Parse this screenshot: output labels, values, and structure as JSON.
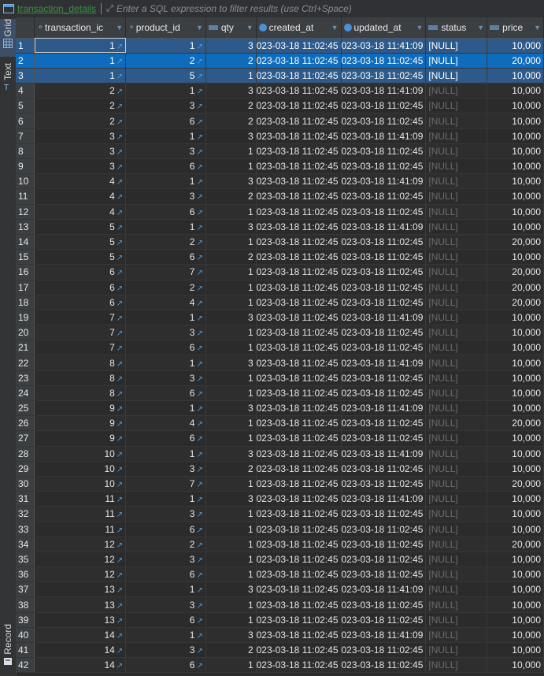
{
  "toolbar": {
    "table_name": "transaction_details",
    "filter_placeholder": "Enter a SQL expression to filter results (use Ctrl+Space)"
  },
  "side_tabs": [
    "Grid",
    "Text",
    "Record"
  ],
  "columns": [
    "transaction_ic",
    "product_id",
    "qty",
    "created_at",
    "updated_at",
    "status",
    "price"
  ],
  "rows": [
    {
      "n": "1",
      "t": "1",
      "p": "1",
      "q": "3",
      "c": "023-03-18 11:02:45",
      "u": "023-03-18 11:41:09",
      "s": "[NULL]",
      "pr": "10,000"
    },
    {
      "n": "2",
      "t": "1",
      "p": "2",
      "q": "2",
      "c": "023-03-18 11:02:45",
      "u": "023-03-18 11:02:45",
      "s": "[NULL]",
      "pr": "20,000"
    },
    {
      "n": "3",
      "t": "1",
      "p": "5",
      "q": "1",
      "c": "023-03-18 11:02:45",
      "u": "023-03-18 11:02:45",
      "s": "[NULL]",
      "pr": "10,000"
    },
    {
      "n": "4",
      "t": "2",
      "p": "1",
      "q": "3",
      "c": "023-03-18 11:02:45",
      "u": "023-03-18 11:41:09",
      "s": "[NULL]",
      "pr": "10,000"
    },
    {
      "n": "5",
      "t": "2",
      "p": "3",
      "q": "2",
      "c": "023-03-18 11:02:45",
      "u": "023-03-18 11:02:45",
      "s": "[NULL]",
      "pr": "10,000"
    },
    {
      "n": "6",
      "t": "2",
      "p": "6",
      "q": "2",
      "c": "023-03-18 11:02:45",
      "u": "023-03-18 11:02:45",
      "s": "[NULL]",
      "pr": "10,000"
    },
    {
      "n": "7",
      "t": "3",
      "p": "1",
      "q": "3",
      "c": "023-03-18 11:02:45",
      "u": "023-03-18 11:41:09",
      "s": "[NULL]",
      "pr": "10,000"
    },
    {
      "n": "8",
      "t": "3",
      "p": "3",
      "q": "1",
      "c": "023-03-18 11:02:45",
      "u": "023-03-18 11:02:45",
      "s": "[NULL]",
      "pr": "10,000"
    },
    {
      "n": "9",
      "t": "3",
      "p": "6",
      "q": "1",
      "c": "023-03-18 11:02:45",
      "u": "023-03-18 11:02:45",
      "s": "[NULL]",
      "pr": "10,000"
    },
    {
      "n": "10",
      "t": "4",
      "p": "1",
      "q": "3",
      "c": "023-03-18 11:02:45",
      "u": "023-03-18 11:41:09",
      "s": "[NULL]",
      "pr": "10,000"
    },
    {
      "n": "11",
      "t": "4",
      "p": "3",
      "q": "2",
      "c": "023-03-18 11:02:45",
      "u": "023-03-18 11:02:45",
      "s": "[NULL]",
      "pr": "10,000"
    },
    {
      "n": "12",
      "t": "4",
      "p": "6",
      "q": "1",
      "c": "023-03-18 11:02:45",
      "u": "023-03-18 11:02:45",
      "s": "[NULL]",
      "pr": "10,000"
    },
    {
      "n": "13",
      "t": "5",
      "p": "1",
      "q": "3",
      "c": "023-03-18 11:02:45",
      "u": "023-03-18 11:41:09",
      "s": "[NULL]",
      "pr": "10,000"
    },
    {
      "n": "14",
      "t": "5",
      "p": "2",
      "q": "1",
      "c": "023-03-18 11:02:45",
      "u": "023-03-18 11:02:45",
      "s": "[NULL]",
      "pr": "20,000"
    },
    {
      "n": "15",
      "t": "5",
      "p": "6",
      "q": "2",
      "c": "023-03-18 11:02:45",
      "u": "023-03-18 11:02:45",
      "s": "[NULL]",
      "pr": "10,000"
    },
    {
      "n": "16",
      "t": "6",
      "p": "7",
      "q": "1",
      "c": "023-03-18 11:02:45",
      "u": "023-03-18 11:02:45",
      "s": "[NULL]",
      "pr": "20,000"
    },
    {
      "n": "17",
      "t": "6",
      "p": "2",
      "q": "1",
      "c": "023-03-18 11:02:45",
      "u": "023-03-18 11:02:45",
      "s": "[NULL]",
      "pr": "20,000"
    },
    {
      "n": "18",
      "t": "6",
      "p": "4",
      "q": "1",
      "c": "023-03-18 11:02:45",
      "u": "023-03-18 11:02:45",
      "s": "[NULL]",
      "pr": "20,000"
    },
    {
      "n": "19",
      "t": "7",
      "p": "1",
      "q": "3",
      "c": "023-03-18 11:02:45",
      "u": "023-03-18 11:41:09",
      "s": "[NULL]",
      "pr": "10,000"
    },
    {
      "n": "20",
      "t": "7",
      "p": "3",
      "q": "1",
      "c": "023-03-18 11:02:45",
      "u": "023-03-18 11:02:45",
      "s": "[NULL]",
      "pr": "10,000"
    },
    {
      "n": "21",
      "t": "7",
      "p": "6",
      "q": "1",
      "c": "023-03-18 11:02:45",
      "u": "023-03-18 11:02:45",
      "s": "[NULL]",
      "pr": "10,000"
    },
    {
      "n": "22",
      "t": "8",
      "p": "1",
      "q": "3",
      "c": "023-03-18 11:02:45",
      "u": "023-03-18 11:41:09",
      "s": "[NULL]",
      "pr": "10,000"
    },
    {
      "n": "23",
      "t": "8",
      "p": "3",
      "q": "1",
      "c": "023-03-18 11:02:45",
      "u": "023-03-18 11:02:45",
      "s": "[NULL]",
      "pr": "10,000"
    },
    {
      "n": "24",
      "t": "8",
      "p": "6",
      "q": "1",
      "c": "023-03-18 11:02:45",
      "u": "023-03-18 11:02:45",
      "s": "[NULL]",
      "pr": "10,000"
    },
    {
      "n": "25",
      "t": "9",
      "p": "1",
      "q": "3",
      "c": "023-03-18 11:02:45",
      "u": "023-03-18 11:41:09",
      "s": "[NULL]",
      "pr": "10,000"
    },
    {
      "n": "26",
      "t": "9",
      "p": "4",
      "q": "1",
      "c": "023-03-18 11:02:45",
      "u": "023-03-18 11:02:45",
      "s": "[NULL]",
      "pr": "20,000"
    },
    {
      "n": "27",
      "t": "9",
      "p": "6",
      "q": "1",
      "c": "023-03-18 11:02:45",
      "u": "023-03-18 11:02:45",
      "s": "[NULL]",
      "pr": "10,000"
    },
    {
      "n": "28",
      "t": "10",
      "p": "1",
      "q": "3",
      "c": "023-03-18 11:02:45",
      "u": "023-03-18 11:41:09",
      "s": "[NULL]",
      "pr": "10,000"
    },
    {
      "n": "29",
      "t": "10",
      "p": "3",
      "q": "2",
      "c": "023-03-18 11:02:45",
      "u": "023-03-18 11:02:45",
      "s": "[NULL]",
      "pr": "10,000"
    },
    {
      "n": "30",
      "t": "10",
      "p": "7",
      "q": "1",
      "c": "023-03-18 11:02:45",
      "u": "023-03-18 11:02:45",
      "s": "[NULL]",
      "pr": "20,000"
    },
    {
      "n": "31",
      "t": "11",
      "p": "1",
      "q": "3",
      "c": "023-03-18 11:02:45",
      "u": "023-03-18 11:41:09",
      "s": "[NULL]",
      "pr": "10,000"
    },
    {
      "n": "32",
      "t": "11",
      "p": "3",
      "q": "1",
      "c": "023-03-18 11:02:45",
      "u": "023-03-18 11:02:45",
      "s": "[NULL]",
      "pr": "10,000"
    },
    {
      "n": "33",
      "t": "11",
      "p": "6",
      "q": "1",
      "c": "023-03-18 11:02:45",
      "u": "023-03-18 11:02:45",
      "s": "[NULL]",
      "pr": "10,000"
    },
    {
      "n": "34",
      "t": "12",
      "p": "2",
      "q": "1",
      "c": "023-03-18 11:02:45",
      "u": "023-03-18 11:02:45",
      "s": "[NULL]",
      "pr": "20,000"
    },
    {
      "n": "35",
      "t": "12",
      "p": "3",
      "q": "1",
      "c": "023-03-18 11:02:45",
      "u": "023-03-18 11:02:45",
      "s": "[NULL]",
      "pr": "10,000"
    },
    {
      "n": "36",
      "t": "12",
      "p": "6",
      "q": "1",
      "c": "023-03-18 11:02:45",
      "u": "023-03-18 11:02:45",
      "s": "[NULL]",
      "pr": "10,000"
    },
    {
      "n": "37",
      "t": "13",
      "p": "1",
      "q": "3",
      "c": "023-03-18 11:02:45",
      "u": "023-03-18 11:41:09",
      "s": "[NULL]",
      "pr": "10,000"
    },
    {
      "n": "38",
      "t": "13",
      "p": "3",
      "q": "1",
      "c": "023-03-18 11:02:45",
      "u": "023-03-18 11:02:45",
      "s": "[NULL]",
      "pr": "10,000"
    },
    {
      "n": "39",
      "t": "13",
      "p": "6",
      "q": "1",
      "c": "023-03-18 11:02:45",
      "u": "023-03-18 11:02:45",
      "s": "[NULL]",
      "pr": "10,000"
    },
    {
      "n": "40",
      "t": "14",
      "p": "1",
      "q": "3",
      "c": "023-03-18 11:02:45",
      "u": "023-03-18 11:41:09",
      "s": "[NULL]",
      "pr": "10,000"
    },
    {
      "n": "41",
      "t": "14",
      "p": "3",
      "q": "2",
      "c": "023-03-18 11:02:45",
      "u": "023-03-18 11:02:45",
      "s": "[NULL]",
      "pr": "10,000"
    },
    {
      "n": "42",
      "t": "14",
      "p": "6",
      "q": "1",
      "c": "023-03-18 11:02:45",
      "u": "023-03-18 11:02:45",
      "s": "[NULL]",
      "pr": "10,000"
    }
  ]
}
